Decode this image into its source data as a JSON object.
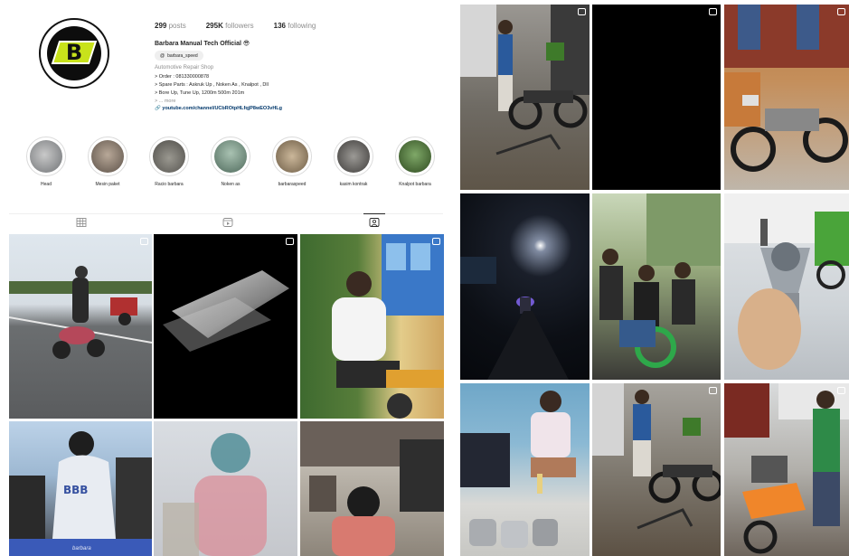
{
  "profile": {
    "stats": {
      "posts_count": "299",
      "posts_label": "posts",
      "followers_count": "295K",
      "followers_label": "followers",
      "following_count": "136",
      "following_label": "following"
    },
    "display_name": "Barbara Manual Tech Official 😎",
    "threads_handle": "barbara_speed",
    "category": "Automotive Repair Shop",
    "bio_lines": [
      "> Order : 081330000878",
      "> Spare Parts : Askruk Up , Noken As , Knalpot , Dll",
      "> Bore Up, Tune Up, 1200m 500m 201m"
    ],
    "bio_more": "> ... more",
    "link": "youtube.com/channel/UCbROtpHLfqjP8wEO3vHLg"
  },
  "highlights": [
    {
      "label": "Head",
      "color": "#8f9395"
    },
    {
      "label": "Mesin paket",
      "color": "#7a6f66"
    },
    {
      "label": "Racio barbara",
      "color": "#6c6a63"
    },
    {
      "label": "Noken as",
      "color": "#6f8a7c"
    },
    {
      "label": "barbaraspeed",
      "color": "#9a8a73"
    },
    {
      "label": "kasim kontrak",
      "color": "#5c5a57"
    },
    {
      "label": "Knalpot barbara",
      "color": "#3f6b2e"
    }
  ],
  "tabs": [
    {
      "name": "posts",
      "icon": "grid-icon"
    },
    {
      "name": "reels",
      "icon": "reels-icon"
    },
    {
      "name": "tagged",
      "icon": "tagged-icon"
    }
  ],
  "watermarks": {
    "barbara_left": "barbara"
  },
  "colors": {
    "accent": "#00376b",
    "muted": "#8e8e8e",
    "text": "#262626",
    "logo_green": "#c8e21b"
  }
}
